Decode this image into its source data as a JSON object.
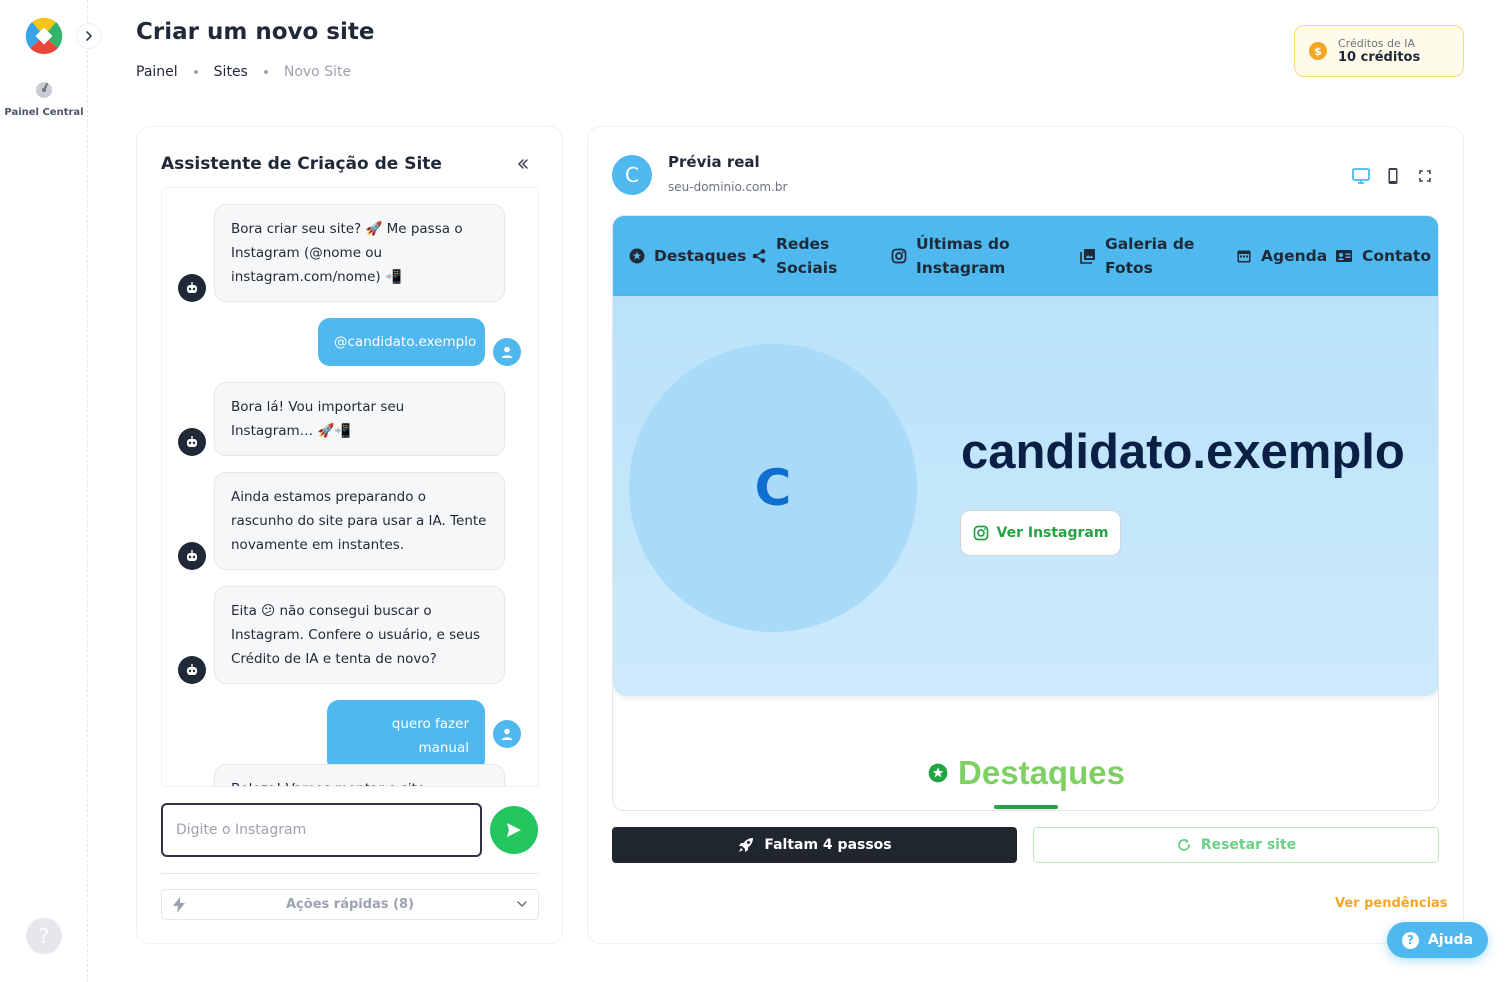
{
  "rail": {
    "nav_label": "Painel Central",
    "help_glyph": "?"
  },
  "header": {
    "title": "Criar um novo site",
    "breadcrumbs": [
      "Painel",
      "Sites",
      "Novo Site"
    ],
    "credits": {
      "label": "Créditos de IA",
      "value": "10 créditos",
      "coin_glyph": "$"
    }
  },
  "chat": {
    "title": "Assistente de Criação de Site",
    "messages": [
      {
        "role": "bot",
        "text": "Bora criar seu site? 🚀 Me passa o Instagram (@nome ou instagram.com/nome) 📲"
      },
      {
        "role": "user",
        "text": "@candidato.exemplo"
      },
      {
        "role": "bot",
        "text": "Bora lá! Vou importar seu Instagram… 🚀📲"
      },
      {
        "role": "bot",
        "text": "Ainda estamos preparando o rascunho do site para usar a IA. Tente novamente em instantes."
      },
      {
        "role": "bot",
        "text": "Eita 😕 não consegui buscar o Instagram. Confere o usuário, e seus Crédito de IA e tenta de novo?"
      },
      {
        "role": "user",
        "text": "quero fazer manual"
      },
      {
        "role": "bot",
        "text": "Beleza! Vamos montar o site"
      }
    ],
    "input_placeholder": "Digite o Instagram",
    "quick_actions_label": "Ações rápidas (8)"
  },
  "preview": {
    "avatar_letter": "C",
    "title": "Prévia real",
    "domain": "seu-dominio.com.br",
    "site": {
      "nav": [
        {
          "label": "Destaques",
          "icon": "star-circle-icon"
        },
        {
          "label": "Redes Sociais",
          "icon": "share-icon"
        },
        {
          "label": "Últimas do Instagram",
          "icon": "instagram-icon"
        },
        {
          "label": "Galeria de Fotos",
          "icon": "photo-library-icon"
        },
        {
          "label": "Agenda",
          "icon": "calendar-icon"
        },
        {
          "label": "Contato",
          "icon": "contact-card-icon"
        }
      ],
      "hero_letter": "C",
      "hero_name": "candidato.exemplo",
      "instagram_button": "Ver Instagram",
      "section_title": "Destaques"
    },
    "steps_button": "Faltam 4 passos",
    "reset_button": "Resetar site",
    "pending_link": "Ver pendências"
  },
  "help_button": {
    "label": "Ajuda",
    "glyph": "?"
  },
  "colors": {
    "accent_blue": "#4fb8ef",
    "send_green": "#22c55e",
    "dark": "#1f2630",
    "credits_bg": "#fffbea",
    "pending_orange": "#f5a623",
    "section_green": "#7ed063"
  }
}
